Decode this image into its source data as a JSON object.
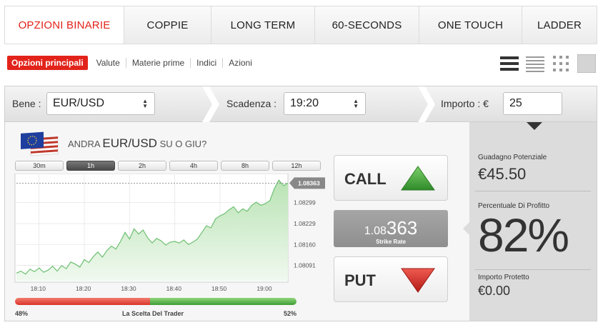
{
  "tabs": [
    {
      "label": "OPZIONI BINARIE",
      "active": true
    },
    {
      "label": "COPPIE"
    },
    {
      "label": "LONG TERM"
    },
    {
      "label": "60-SECONDS"
    },
    {
      "label": "ONE TOUCH"
    },
    {
      "label": "LADDER"
    }
  ],
  "subnav": {
    "active": "Opzioni principali",
    "items": [
      "Valute",
      "Materie prime",
      "Indici",
      "Azioni"
    ]
  },
  "view_icons": [
    "list-view-icon",
    "compact-list-icon",
    "grid-view-icon",
    "tile-view-icon"
  ],
  "toolbar": {
    "asset_label": "Bene :",
    "asset_value": "EUR/USD",
    "expiry_label": "Scadenza :",
    "expiry_value": "19:20",
    "amount_label": "Importo : €",
    "amount_value": "25"
  },
  "question": {
    "prefix": "ANDRA",
    "pair": "EUR/USD",
    "suffix": "SU O GIU?"
  },
  "periods": [
    {
      "label": "30m"
    },
    {
      "label": "1h",
      "active": true
    },
    {
      "label": "2h"
    },
    {
      "label": "4h"
    },
    {
      "label": "8h"
    },
    {
      "label": "12h"
    }
  ],
  "chart_data": {
    "type": "area",
    "x_ticks": [
      "18:10",
      "18:20",
      "18:30",
      "18:40",
      "18:50",
      "19:00"
    ],
    "y_ticks": [
      "1.08299",
      "1.08229",
      "1.08160",
      "1.08091"
    ],
    "current_label": "1.08363",
    "x": [
      "18:05",
      "18:06",
      "18:07",
      "18:08",
      "18:09",
      "18:10",
      "18:11",
      "18:12",
      "18:13",
      "18:14",
      "18:15",
      "18:16",
      "18:17",
      "18:18",
      "18:19",
      "18:20",
      "18:21",
      "18:22",
      "18:23",
      "18:24",
      "18:25",
      "18:26",
      "18:27",
      "18:28",
      "18:29",
      "18:30",
      "18:31",
      "18:32",
      "18:33",
      "18:34",
      "18:35",
      "18:36",
      "18:37",
      "18:38",
      "18:39",
      "18:40",
      "18:41",
      "18:42",
      "18:43",
      "18:44",
      "18:45",
      "18:46",
      "18:47",
      "18:48",
      "18:49",
      "18:50",
      "18:51",
      "18:52",
      "18:53",
      "18:54",
      "18:55",
      "18:56",
      "18:57",
      "18:58",
      "18:59",
      "19:00",
      "19:01",
      "19:02",
      "19:03",
      "19:04",
      "19:05"
    ],
    "y": [
      1.08065,
      1.08072,
      1.08062,
      1.08078,
      1.0807,
      1.08082,
      1.08068,
      1.08075,
      1.08088,
      1.08072,
      1.0809,
      1.0808,
      1.08102,
      1.08095,
      1.08085,
      1.0811,
      1.081,
      1.0812,
      1.08135,
      1.08118,
      1.0814,
      1.08155,
      1.08145,
      1.0817,
      1.082,
      1.08178,
      1.08212,
      1.08195,
      1.08208,
      1.08182,
      1.08165,
      1.0818,
      1.08172,
      1.08158,
      1.08168,
      1.0817,
      1.08165,
      1.08175,
      1.0816,
      1.08168,
      1.08178,
      1.082,
      1.08222,
      1.08215,
      1.08245,
      1.08255,
      1.08262,
      1.08275,
      1.08285,
      1.08265,
      1.08278,
      1.0827,
      1.0829,
      1.083,
      1.0829,
      1.08295,
      1.08305,
      1.08345,
      1.08373,
      1.08355,
      1.08363
    ],
    "ylim": [
      1.0804,
      1.0839
    ],
    "colors": {
      "line": "#6dbf72",
      "fill_top": "#b9e3b4",
      "fill_bottom": "#f0f9ef"
    }
  },
  "sentiment": {
    "left_pct": "48%",
    "center": "La Scelta Del Trader",
    "right_pct": "52%",
    "left_value": 48,
    "right_value": 52,
    "colors": {
      "put": "#e0443a",
      "call": "#53ad45"
    }
  },
  "call": {
    "label": "CALL",
    "color": "#3a9a3a"
  },
  "put": {
    "label": "PUT",
    "color": "#cc2222"
  },
  "strike": {
    "prefix": "1.08",
    "suffix": "363",
    "label": "Strike Rate"
  },
  "stats": {
    "profit_label": "Guadagno Potenziale",
    "profit_value": "€45.50",
    "percent_label": "Percentuale Di Profitto",
    "percent_value": "82%",
    "protected_label": "Importo Protetto",
    "protected_value": "€0.00"
  },
  "accent": "#e2231a"
}
